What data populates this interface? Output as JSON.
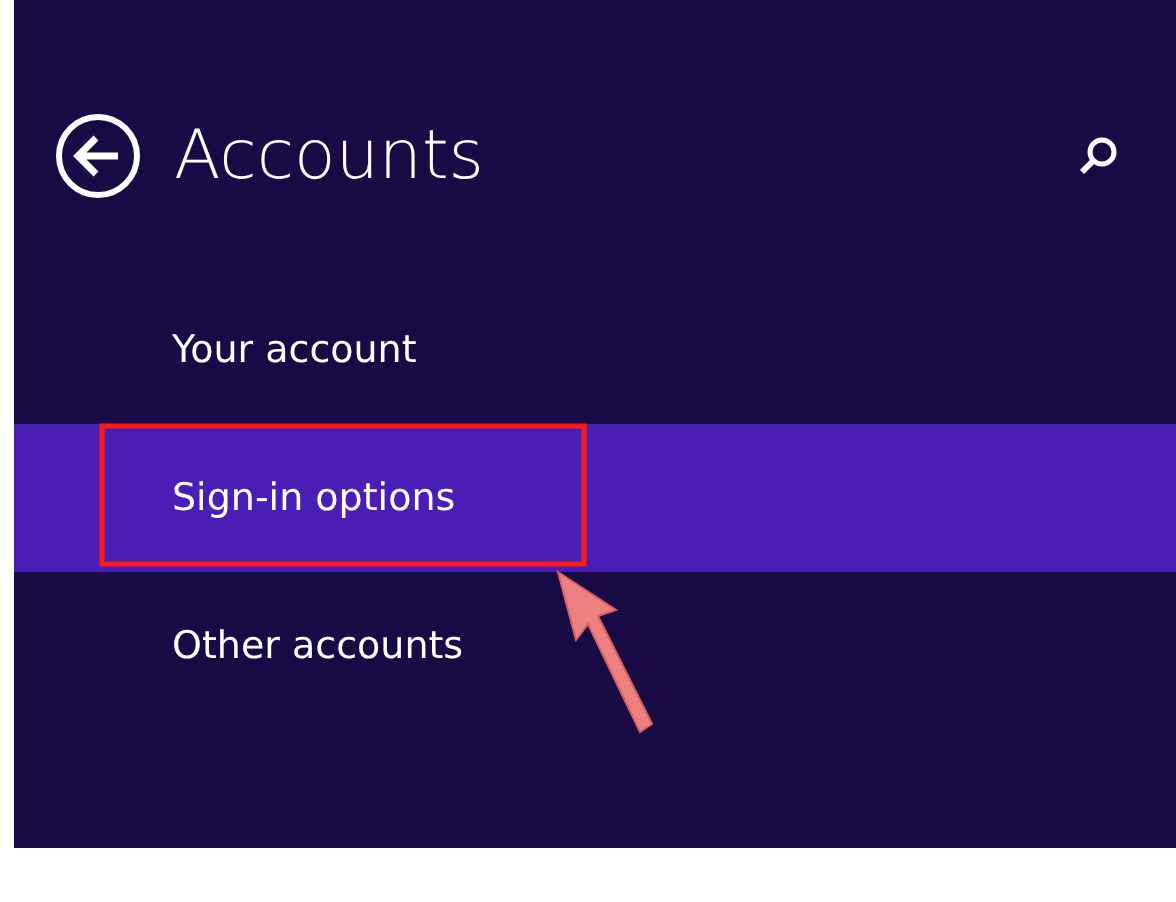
{
  "header": {
    "title": "Accounts"
  },
  "items": [
    {
      "label": "Your account",
      "selected": false
    },
    {
      "label": "Sign-in options",
      "selected": true
    },
    {
      "label": "Other accounts",
      "selected": false
    }
  ]
}
